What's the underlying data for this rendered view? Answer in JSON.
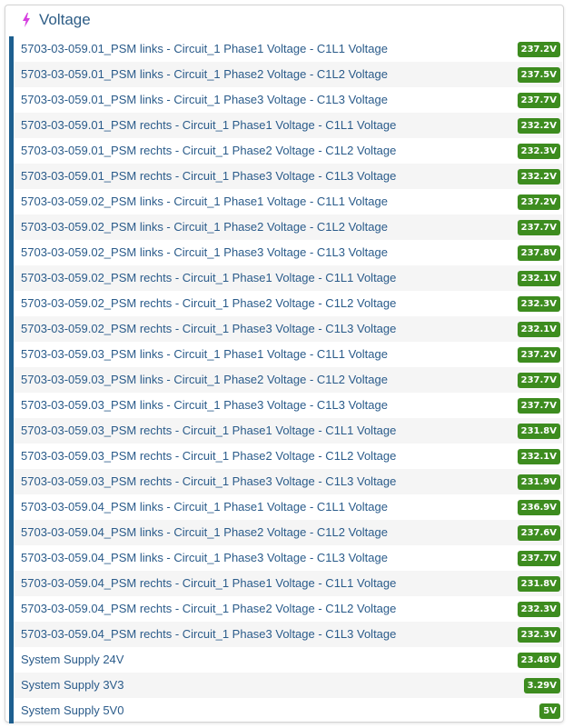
{
  "panel": {
    "title": "Voltage",
    "icon": "lightning-bolt-icon",
    "icon_color": "#d63fe0",
    "accent_color": "#1d5f8f",
    "badge_color": "#3d8c1f"
  },
  "rows": [
    {
      "label": "5703-03-059.01_PSM links - Circuit_1 Phase1 Voltage - C1L1 Voltage",
      "value": "237.2V"
    },
    {
      "label": "5703-03-059.01_PSM links - Circuit_1 Phase2 Voltage - C1L2 Voltage",
      "value": "237.5V"
    },
    {
      "label": "5703-03-059.01_PSM links - Circuit_1 Phase3 Voltage - C1L3 Voltage",
      "value": "237.7V"
    },
    {
      "label": "5703-03-059.01_PSM rechts - Circuit_1 Phase1 Voltage - C1L1 Voltage",
      "value": "232.2V"
    },
    {
      "label": "5703-03-059.01_PSM rechts - Circuit_1 Phase2 Voltage - C1L2 Voltage",
      "value": "232.3V"
    },
    {
      "label": "5703-03-059.01_PSM rechts - Circuit_1 Phase3 Voltage - C1L3 Voltage",
      "value": "232.2V"
    },
    {
      "label": "5703-03-059.02_PSM links - Circuit_1 Phase1 Voltage - C1L1 Voltage",
      "value": "237.2V"
    },
    {
      "label": "5703-03-059.02_PSM links - Circuit_1 Phase2 Voltage - C1L2 Voltage",
      "value": "237.7V"
    },
    {
      "label": "5703-03-059.02_PSM links - Circuit_1 Phase3 Voltage - C1L3 Voltage",
      "value": "237.8V"
    },
    {
      "label": "5703-03-059.02_PSM rechts - Circuit_1 Phase1 Voltage - C1L1 Voltage",
      "value": "232.1V"
    },
    {
      "label": "5703-03-059.02_PSM rechts - Circuit_1 Phase2 Voltage - C1L2 Voltage",
      "value": "232.3V"
    },
    {
      "label": "5703-03-059.02_PSM rechts - Circuit_1 Phase3 Voltage - C1L3 Voltage",
      "value": "232.1V"
    },
    {
      "label": "5703-03-059.03_PSM links - Circuit_1 Phase1 Voltage - C1L1 Voltage",
      "value": "237.2V"
    },
    {
      "label": "5703-03-059.03_PSM links - Circuit_1 Phase2 Voltage - C1L2 Voltage",
      "value": "237.7V"
    },
    {
      "label": "5703-03-059.03_PSM links - Circuit_1 Phase3 Voltage - C1L3 Voltage",
      "value": "237.7V"
    },
    {
      "label": "5703-03-059.03_PSM rechts - Circuit_1 Phase1 Voltage - C1L1 Voltage",
      "value": "231.8V"
    },
    {
      "label": "5703-03-059.03_PSM rechts - Circuit_1 Phase2 Voltage - C1L2 Voltage",
      "value": "232.1V"
    },
    {
      "label": "5703-03-059.03_PSM rechts - Circuit_1 Phase3 Voltage - C1L3 Voltage",
      "value": "231.9V"
    },
    {
      "label": "5703-03-059.04_PSM links - Circuit_1 Phase1 Voltage - C1L1 Voltage",
      "value": "236.9V"
    },
    {
      "label": "5703-03-059.04_PSM links - Circuit_1 Phase2 Voltage - C1L2 Voltage",
      "value": "237.6V"
    },
    {
      "label": "5703-03-059.04_PSM links - Circuit_1 Phase3 Voltage - C1L3 Voltage",
      "value": "237.7V"
    },
    {
      "label": "5703-03-059.04_PSM rechts - Circuit_1 Phase1 Voltage - C1L1 Voltage",
      "value": "231.8V"
    },
    {
      "label": "5703-03-059.04_PSM rechts - Circuit_1 Phase2 Voltage - C1L2 Voltage",
      "value": "232.3V"
    },
    {
      "label": "5703-03-059.04_PSM rechts - Circuit_1 Phase3 Voltage - C1L3 Voltage",
      "value": "232.3V"
    },
    {
      "label": "System Supply 24V",
      "value": "23.48V"
    },
    {
      "label": "System Supply 3V3",
      "value": "3.29V"
    },
    {
      "label": "System Supply 5V0",
      "value": "5V"
    }
  ]
}
